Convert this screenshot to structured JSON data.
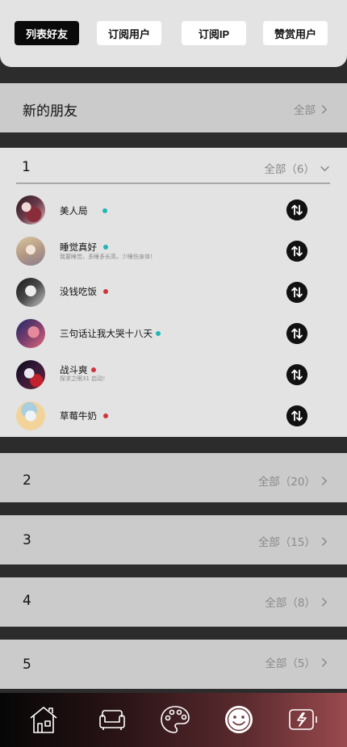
{
  "tabs": [
    {
      "label": "列表好友",
      "active": true
    },
    {
      "label": "订阅用户",
      "active": false
    },
    {
      "label": "订阅IP",
      "active": false
    },
    {
      "label": "赞赏用户",
      "active": false
    }
  ],
  "new_friends": {
    "title": "新的朋友",
    "more": "全部"
  },
  "group_1": {
    "name": "1",
    "more": "全部（6）",
    "friends": [
      {
        "name": "美人局",
        "status_color": "#1fb8b3"
      },
      {
        "name": "睡觉真好",
        "subtitle": "我要睡觉，多睡多长高，少睡伤身体！",
        "status_color": "#1fb8b3"
      },
      {
        "name": "没钱吃饭",
        "status_color": "#d0343a"
      },
      {
        "name": "三句话让我大哭十八天",
        "status_color": "#1fb8b3"
      },
      {
        "name": "战斗爽",
        "subtitle": "探求之眼31 启动！",
        "status_color": "#d0343a"
      },
      {
        "name": "草莓牛奶",
        "status_color": "#d0343a"
      }
    ]
  },
  "groups": [
    {
      "name": "2",
      "more": "全部（20）"
    },
    {
      "name": "3",
      "more": "全部（15）"
    },
    {
      "name": "4",
      "more": "全部（8）"
    },
    {
      "name": "5",
      "more": "全部（5）"
    }
  ],
  "nav": {
    "items": [
      "home-icon",
      "sofa-icon",
      "palette-icon",
      "face-icon",
      "battery-icon"
    ],
    "active_index": 3
  },
  "colors": {
    "online": "#1fb8b3",
    "busy": "#d0343a",
    "accent_dark": "#0a0a0a"
  }
}
